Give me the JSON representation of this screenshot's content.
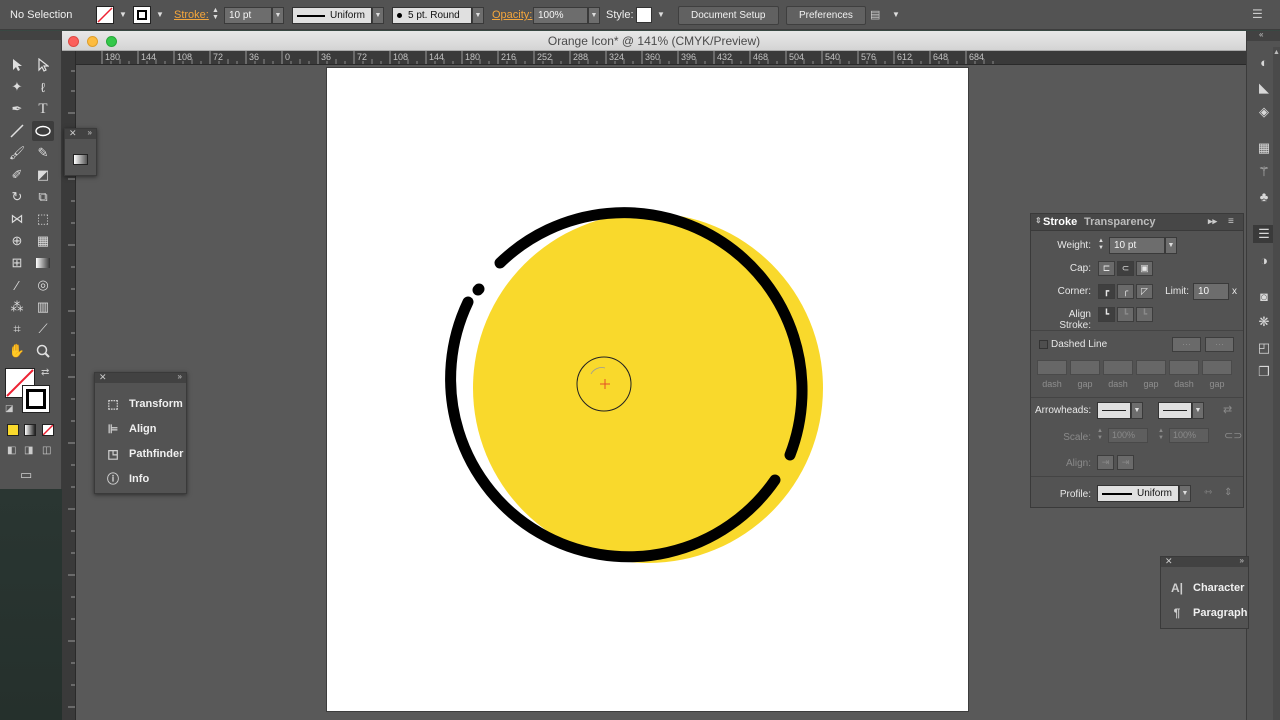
{
  "control_bar": {
    "selection_status": "No Selection",
    "stroke_label": "Stroke:",
    "stroke_weight": "10 pt",
    "stroke_profile": "Uniform",
    "brush_definition": "5 pt. Round",
    "opacity_label": "Opacity:",
    "opacity_value": "100%",
    "style_label": "Style:",
    "document_setup_label": "Document Setup",
    "preferences_label": "Preferences"
  },
  "document": {
    "title": "Orange Icon* @ 141% (CMYK/Preview)",
    "ruler_ticks": [
      "180",
      "144",
      "108",
      "72",
      "36",
      "0",
      "36",
      "72",
      "108",
      "144",
      "180",
      "216",
      "252",
      "288",
      "324",
      "360",
      "396",
      "432",
      "468",
      "504",
      "540",
      "576",
      "612",
      "648",
      "684"
    ]
  },
  "artwork": {
    "fill_color": "#F9D92C",
    "stroke_color": "#000000",
    "background_color": "#FFFFFF"
  },
  "quick_panel": {
    "items": [
      {
        "label": "Transform",
        "icon": "transform-icon"
      },
      {
        "label": "Align",
        "icon": "align-icon"
      },
      {
        "label": "Pathfinder",
        "icon": "pathfinder-icon"
      },
      {
        "label": "Info",
        "icon": "info-icon"
      }
    ]
  },
  "stroke_panel": {
    "tab_stroke": "Stroke",
    "tab_transparency": "Transparency",
    "weight_label": "Weight:",
    "weight_value": "10 pt",
    "cap_label": "Cap:",
    "corner_label": "Corner:",
    "limit_label": "Limit:",
    "limit_value": "10",
    "limit_unit": "x",
    "align_stroke_label": "Align Stroke:",
    "dashed_line_label": "Dashed Line",
    "dash_labels": [
      "dash",
      "gap",
      "dash",
      "gap",
      "dash",
      "gap"
    ],
    "arrowheads_label": "Arrowheads:",
    "scale_label": "Scale:",
    "scale_value_1": "100%",
    "scale_value_2": "100%",
    "align_label": "Align:",
    "profile_label": "Profile:",
    "profile_value": "Uniform"
  },
  "char_panel": {
    "items": [
      {
        "label": "Character",
        "icon": "character-icon"
      },
      {
        "label": "Paragraph",
        "icon": "paragraph-icon"
      }
    ]
  }
}
